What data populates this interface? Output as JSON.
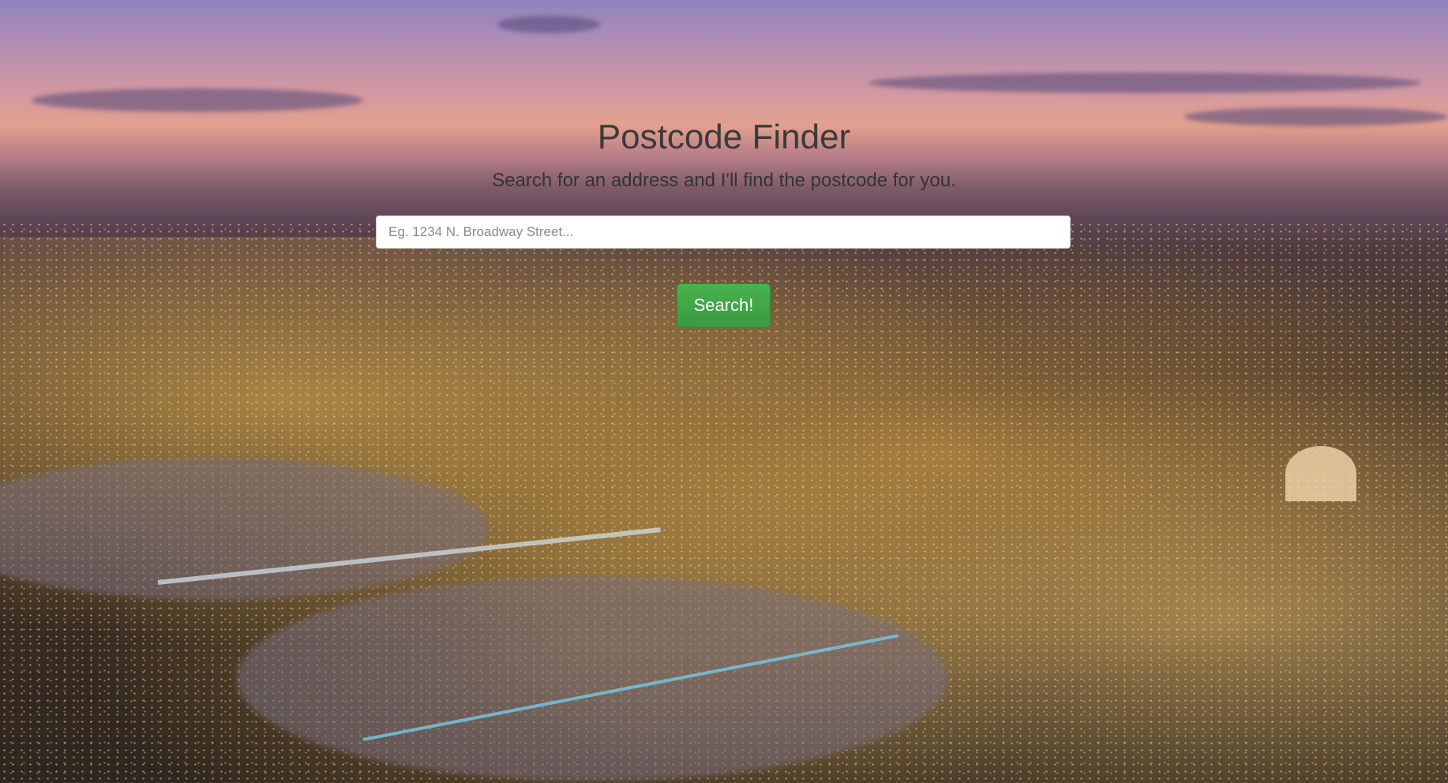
{
  "page": {
    "title": "Postcode Finder",
    "subtitle": "Search for an address and I'll find the postcode for you."
  },
  "search": {
    "placeholder": "Eg. 1234 N. Broadway Street...",
    "value": "",
    "button_label": "Search!"
  },
  "colors": {
    "button_green": "#3a9a40",
    "title_text": "#3a3a3a"
  }
}
